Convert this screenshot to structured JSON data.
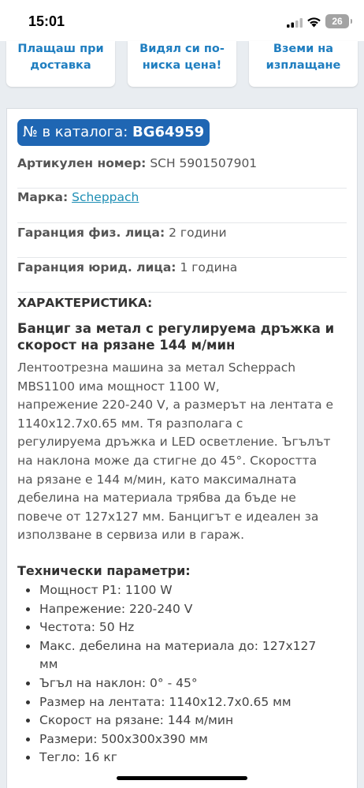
{
  "status_bar": {
    "time": "15:01",
    "battery": "26"
  },
  "promo_buttons": [
    {
      "line1": "Плащаш при",
      "line2": "доставка"
    },
    {
      "line1": "Видял си по-",
      "line2": "ниска цена!"
    },
    {
      "line1": "Вземи на",
      "line2": "изплащане"
    }
  ],
  "catalog": {
    "label": "№ в каталога:",
    "number": "BG64959"
  },
  "info": {
    "article_label": "Артикулен номер:",
    "article_value": "SCH 5901507901",
    "brand_label": "Марка:",
    "brand_value": "Scheppach",
    "warranty_private_label": "Гаранция физ. лица:",
    "warranty_private_value": "2 години",
    "warranty_company_label": "Гаранция юрид. лица:",
    "warranty_company_value": "1 година"
  },
  "characteristics_title": "ХАРАКТЕРИСТИКА:",
  "product_title": "Банциг за метал с регулируема дръжка и скорост на рязане 144 м/мин",
  "description_lines": [
    "Лентоотрезна машина за метал Scheppach",
    "MBS1100 има мощност 1100 W,",
    "напрежение 220-240 V, а размерът на лентата е",
    "1140x12.7x0.65 мм. Тя разполага с",
    "регулируема дръжка и LED осветление. Ъгълът",
    "на наклона може да стигне до 45°. Скоростта",
    "на рязане е 144 м/мин, като максималната",
    "дебелина на материала трябва да бъде не",
    "повече от 127x127 мм. Банцигът е идеален за",
    "използване в сервиза или в гараж."
  ],
  "tech_title": "Технически параметри:",
  "specs": [
    "Мощност P1: 1100 W",
    "Напрежение: 220-240 V",
    "Честота: 50 Hz",
    "Макс. дебелина на материала до: 127x127",
    "мм",
    "Ъгъл на наклон: 0° - 45°",
    "Размер на лентата: 1140x12.7x0.65 мм",
    "Скорост на рязане: 144 м/мин",
    "Размери: 500x300x390 мм",
    "Тегло: 16 кг"
  ]
}
